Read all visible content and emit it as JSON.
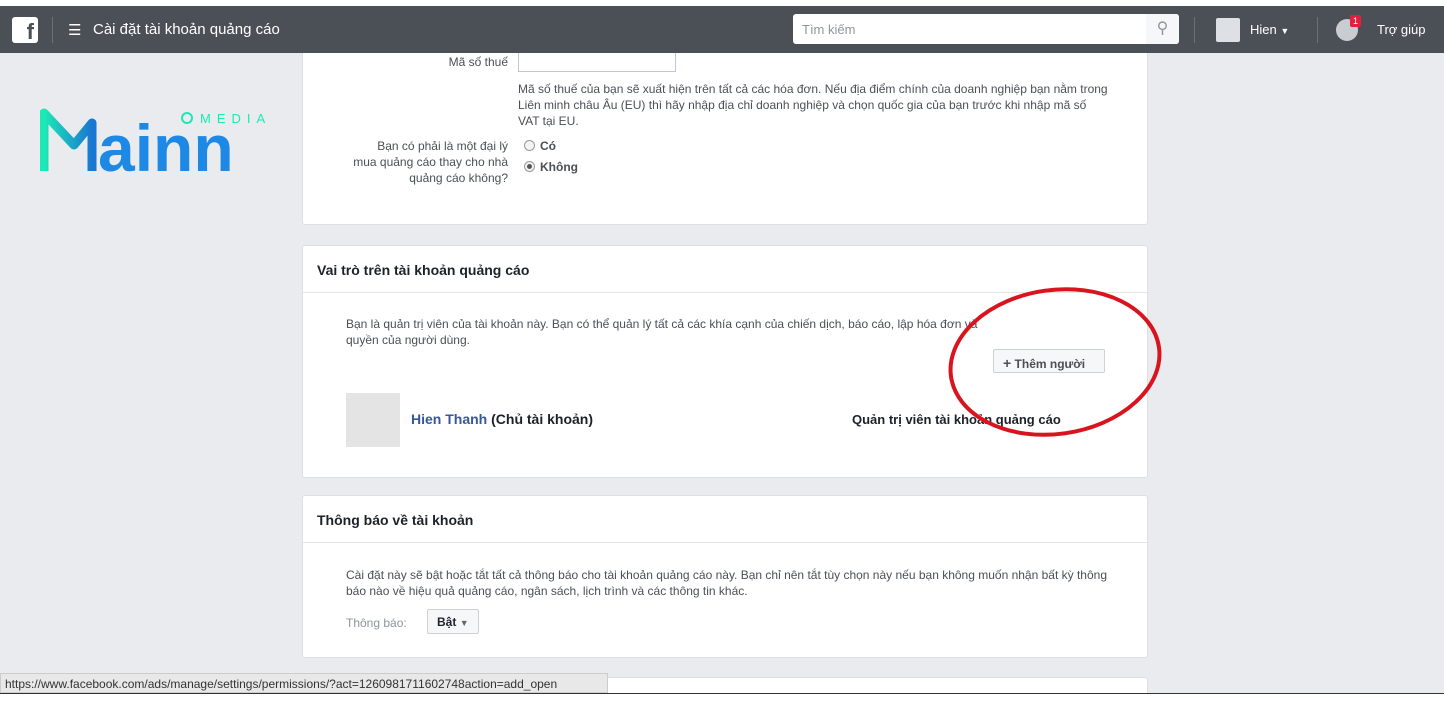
{
  "topbar": {
    "title": "Cài đặt tài khoản quảng cáo",
    "search_placeholder": "Tìm kiếm",
    "user": "Hien",
    "notification_count": "1",
    "help": "Trợ giúp"
  },
  "logo": {
    "text": "Mainn",
    "sub": "MEDIA",
    "colors": [
      "#1de9b6",
      "#1976d2"
    ]
  },
  "tax": {
    "label": "Mã số thuế",
    "value": "",
    "help": "Mã số thuế của bạn sẽ xuất hiện trên tất cả các hóa đơn. Nếu địa điểm chính của doanh nghiệp bạn nằm trong Liên minh châu Âu (EU) thì hãy nhập địa chỉ doanh nghiệp và chọn quốc gia của bạn trước khi nhập mã số VAT tại EU.",
    "agency_question": "Bạn có phải là một đại lý mua quảng cáo thay cho nhà quảng cáo không?",
    "options": [
      "Có",
      "Không"
    ],
    "selected": "Không"
  },
  "roles": {
    "title": "Vai trò trên tài khoản quảng cáo",
    "description": "Bạn là quản trị viên của tài khoản này. Bạn có thể quản lý tất cả các khía cạnh của chiến dịch, báo cáo, lập hóa đơn và quyền của người dùng.",
    "add_button": "Thêm người",
    "member_name": "Hien Thanh",
    "member_note": "(Chủ tài khoản)",
    "member_role": "Quản trị viên tài khoản quảng cáo"
  },
  "notifications": {
    "title": "Thông báo về tài khoản",
    "description": "Cài đặt này sẽ bật hoặc tắt tất cả thông báo cho tài khoản quảng cáo này. Bạn chỉ nên tắt tùy chọn này nếu bạn không muốn nhận bất kỳ thông báo nào về hiệu quả quảng cáo, ngân sách, lịch trình và các thông tin khác.",
    "label": "Thông báo:",
    "value": "Bật"
  },
  "status_url": "https://www.facebook.com/ads/manage/settings/permissions/?act=1260981711602748action=add_open",
  "annotation_color": "#d9141e"
}
